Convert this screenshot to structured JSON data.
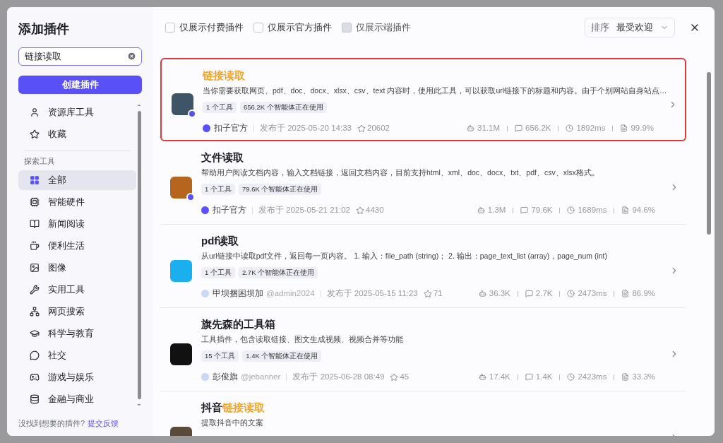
{
  "sidebar": {
    "title": "添加插件",
    "search": {
      "value": "链接读取"
    },
    "create_button": "创建插件",
    "top_items": [
      {
        "label": "资源库工具",
        "selected": false
      },
      {
        "label": "收藏",
        "selected": false
      }
    ],
    "section_label": "探索工具",
    "categories": [
      {
        "label": "全部",
        "selected": true
      },
      {
        "label": "智能硬件",
        "selected": false
      },
      {
        "label": "新闻阅读",
        "selected": false
      },
      {
        "label": "便利生活",
        "selected": false
      },
      {
        "label": "图像",
        "selected": false
      },
      {
        "label": "实用工具",
        "selected": false
      },
      {
        "label": "网页搜索",
        "selected": false
      },
      {
        "label": "科学与教育",
        "selected": false
      },
      {
        "label": "社交",
        "selected": false
      },
      {
        "label": "游戏与娱乐",
        "selected": false
      },
      {
        "label": "金融与商业",
        "selected": false
      }
    ],
    "footer": {
      "text": "没找到想要的插件?",
      "link": "提交反馈"
    }
  },
  "filters": [
    {
      "label": "仅展示付费插件",
      "checked": false,
      "disabled": false
    },
    {
      "label": "仅展示官方插件",
      "checked": false,
      "disabled": false
    },
    {
      "label": "仅展示端插件",
      "checked": false,
      "disabled": true
    }
  ],
  "sort": {
    "label": "排序",
    "value": "最受欢迎"
  },
  "plugins": [
    {
      "title": [
        {
          "text": "链接读取",
          "highlight": true
        }
      ],
      "highlighted": true,
      "official": true,
      "description": "当你需要获取网页、pdf、doc、docx、xlsx、csv、text 内容时，使用此工具，可以获取url链接下的标题和内容。由于个别网站自身站点…",
      "tags": [
        "1 个工具",
        "656.2K 个智能体正在使用"
      ],
      "author": "扣子官方",
      "published": "发布于 2025-05-20 14:33",
      "stars": "20602",
      "stats": [
        "31.1M",
        "656.2K",
        "1892ms",
        "99.9%"
      ]
    },
    {
      "title": [
        {
          "text": "文件读取",
          "highlight": false
        }
      ],
      "highlighted": false,
      "official": true,
      "description": "帮助用户阅读文档内容，输入文档链接，返回文档内容，目前支持html、xml、doc、docx、txt、pdf、csv、xlsx格式。",
      "tags": [
        "1 个工具",
        "79.6K 个智能体正在使用"
      ],
      "author": "扣子官方",
      "published": "发布于 2025-05-21 21:02",
      "stars": "4430",
      "stats": [
        "1.3M",
        "79.6K",
        "1689ms",
        "94.6%"
      ]
    },
    {
      "title": [
        {
          "text": "pdf读取",
          "highlight": false
        }
      ],
      "highlighted": false,
      "official": false,
      "description": "从url链接中读取pdf文件，返回每一页内容。 1. 输入：file_path (string)； 2. 输出：page_text_list (array)，page_num (int)",
      "tags": [
        "1 个工具",
        "2.7K 个智能体正在使用"
      ],
      "author": "甲坝捆困坝加",
      "handle": "@admin2024",
      "published": "发布于 2025-05-15 11:23",
      "stars": "71",
      "stats": [
        "36.3K",
        "2.7K",
        "2473ms",
        "86.9%"
      ]
    },
    {
      "title": [
        {
          "text": "旗先森的工具箱",
          "highlight": false
        }
      ],
      "highlighted": false,
      "official": false,
      "description": "工具插件，包含读取链接、图文生成视频、视频合并等功能",
      "tags": [
        "15 个工具",
        "1.4K 个智能体正在使用"
      ],
      "author": "彭俊旗",
      "handle": "@jebanner",
      "published": "发布于 2025-06-28 08:49",
      "stars": "45",
      "stats": [
        "17.4K",
        "1.4K",
        "2423ms",
        "33.3%"
      ]
    },
    {
      "title": [
        {
          "text": "抖音",
          "highlight": false
        },
        {
          "text": "链接读取",
          "highlight": true
        }
      ],
      "highlighted": false,
      "official": false,
      "description": "提取抖音中的文案"
    }
  ]
}
